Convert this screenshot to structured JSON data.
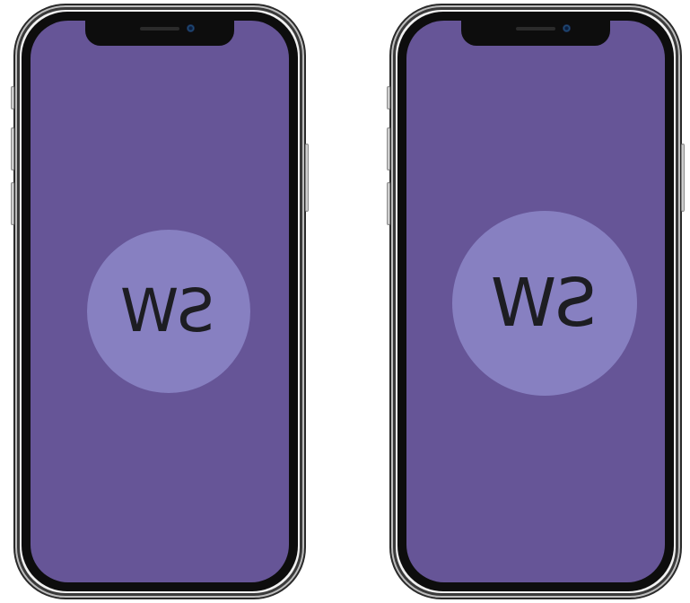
{
  "colors": {
    "screen_bg": "#665597",
    "logo_circle": "#8780c1",
    "logo_text": "#1d1d22"
  },
  "phones": [
    {
      "logo_text": "SW"
    },
    {
      "logo_text": "SW"
    }
  ]
}
